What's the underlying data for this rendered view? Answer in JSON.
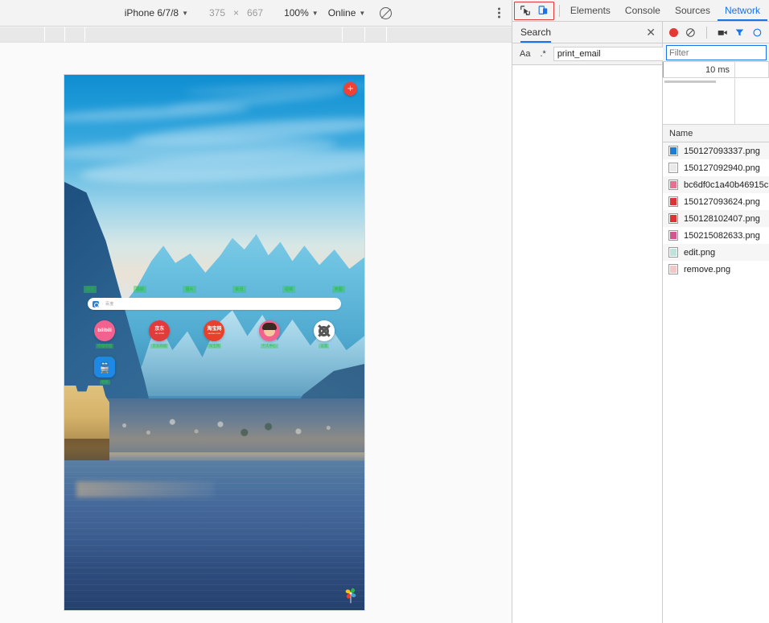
{
  "device_toolbar": {
    "device_name": "iPhone 6/7/8",
    "width": "375",
    "times": "×",
    "height": "667",
    "zoom": "100%",
    "throttle": "Online",
    "rotate_icon": "rotate-icon",
    "more_icon": "more-options-icon"
  },
  "phone": {
    "add_button": "+",
    "categories": [
      {
        "label": "网页"
      },
      {
        "label": "视频"
      },
      {
        "label": "图片"
      },
      {
        "label": "资讯"
      },
      {
        "label": "视频"
      },
      {
        "label": "地图"
      }
    ],
    "search": {
      "logo": "baidu-logo-icon",
      "placeholder": "· 百度"
    },
    "apps": [
      {
        "name": "bilibili",
        "icon_text": "bilibili",
        "icon_sub": "",
        "label": "哔哩哔哩",
        "bg": "#f3628f",
        "kind": "text"
      },
      {
        "name": "jd",
        "icon_text": "京东",
        "icon_sub": "JD.COM",
        "label": "京东商城",
        "bg": "#e23b3b",
        "kind": "text"
      },
      {
        "name": "taobao",
        "icon_text": "淘宝网",
        "icon_sub": "taobao.com",
        "label": "淘宝网",
        "bg": "#e8402a",
        "kind": "text"
      },
      {
        "name": "profile",
        "icon_text": "",
        "icon_sub": "",
        "label": "个人中心",
        "bg": "#f3628f",
        "kind": "avatar"
      },
      {
        "name": "settings",
        "icon_text": "",
        "icon_sub": "",
        "label": "设置",
        "bg": "#ffffff",
        "kind": "gear"
      },
      {
        "name": "metro",
        "icon_text": "",
        "icon_sub": "",
        "label": "地铁",
        "bg": "#1e88e5",
        "kind": "metro"
      }
    ],
    "brand_icon": "pinwheel-logo-icon"
  },
  "devtools": {
    "inspect_icon": "inspect-element-icon",
    "device_toggle_icon": "toggle-device-toolbar-icon",
    "tabs": [
      {
        "label": "Elements",
        "active": false
      },
      {
        "label": "Console",
        "active": false
      },
      {
        "label": "Sources",
        "active": false
      },
      {
        "label": "Network",
        "active": true
      }
    ],
    "search_panel": {
      "tab_label": "Search",
      "close_icon": "close-icon",
      "match_case_label": "Aa",
      "regex_label": ".*",
      "query": "print_email",
      "refresh_icon": "refresh-icon",
      "clear_icon": "clear-icon"
    },
    "network_panel": {
      "record_icon": "record-button-icon",
      "clear_icon": "clear-network-icon",
      "capture_screenshots_icon": "camera-icon",
      "filter_icon": "filter-funnel-icon",
      "settings_icon": "gear-icon",
      "filter_placeholder": "Filter",
      "overview_time": "10 ms",
      "column_header": "Name",
      "requests": [
        {
          "name": "150127093337.png",
          "thumb": "#1a7fd4"
        },
        {
          "name": "150127092940.png",
          "thumb": "#cfcfcf"
        },
        {
          "name": "bc6df0c1a40b46915c",
          "thumb": "#e0738f"
        },
        {
          "name": "150127093624.png",
          "thumb": "#e03232"
        },
        {
          "name": "150128102407.png",
          "thumb": "#e03232"
        },
        {
          "name": "150215082633.png",
          "thumb": "#d2568e"
        },
        {
          "name": "edit.png",
          "thumb": "#bfe3dc"
        },
        {
          "name": "remove.png",
          "thumb": "#f2c7c7"
        }
      ]
    }
  }
}
